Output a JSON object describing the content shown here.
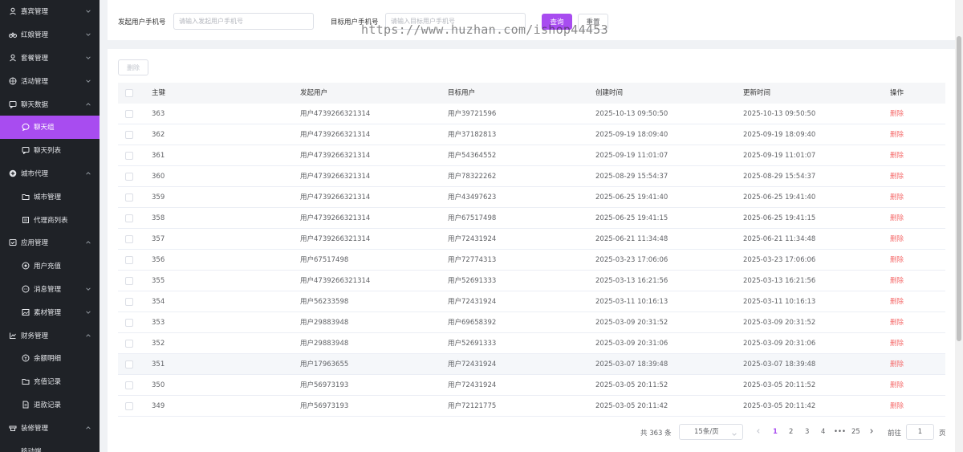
{
  "sidebar": {
    "items": [
      {
        "label": "嘉宾管理",
        "icon": "user-icon",
        "level": "top",
        "chevron": "down"
      },
      {
        "label": "红娘管理",
        "icon": "bike-icon",
        "level": "top",
        "chevron": "down"
      },
      {
        "label": "套餐管理",
        "icon": "user-icon",
        "level": "top",
        "chevron": "down"
      },
      {
        "label": "活动管理",
        "icon": "basketball-icon",
        "level": "top",
        "chevron": "down"
      },
      {
        "label": "聊天数据",
        "icon": "chat-icon",
        "level": "top",
        "chevron": "up"
      },
      {
        "label": "聊天组",
        "icon": "chat-bubble-icon",
        "level": "sub",
        "active": true
      },
      {
        "label": "聊天列表",
        "icon": "chat-icon",
        "level": "sub"
      },
      {
        "label": "城市代理",
        "icon": "plus-circle-icon",
        "level": "top",
        "chevron": "up"
      },
      {
        "label": "城市管理",
        "icon": "folder-icon",
        "level": "sub"
      },
      {
        "label": "代理商列表",
        "icon": "list-icon",
        "level": "sub"
      },
      {
        "label": "应用管理",
        "icon": "app-icon",
        "level": "top",
        "chevron": "up"
      },
      {
        "label": "用户充值",
        "icon": "target-icon",
        "level": "sub"
      },
      {
        "label": "消息管理",
        "icon": "message-icon",
        "level": "sub",
        "chevron": "down"
      },
      {
        "label": "素材管理",
        "icon": "picture-icon",
        "level": "sub",
        "chevron": "down"
      },
      {
        "label": "财务管理",
        "icon": "chart-icon",
        "level": "top",
        "chevron": "up"
      },
      {
        "label": "余额明细",
        "icon": "wallet-icon",
        "level": "sub"
      },
      {
        "label": "充值记录",
        "icon": "folder-icon",
        "level": "sub"
      },
      {
        "label": "退款记录",
        "icon": "document-icon",
        "level": "sub"
      },
      {
        "label": "装修管理",
        "icon": "decor-icon",
        "level": "top",
        "chevron": "up"
      },
      {
        "label": "移动端",
        "icon": "",
        "level": "sub"
      }
    ]
  },
  "search": {
    "from_label": "发起用户手机号",
    "from_placeholder": "请输入发起用户手机号",
    "to_label": "目标用户手机号",
    "to_placeholder": "请输入目标用户手机号",
    "query_label": "查询",
    "reset_label": "重置"
  },
  "watermark": "https://www.huzhan.com/ishop44453",
  "toolbar": {
    "delete_label": "删除"
  },
  "table": {
    "headers": {
      "id": "主键",
      "from": "发起用户",
      "to": "目标用户",
      "created": "创建时间",
      "updated": "更新时间",
      "op": "操作"
    },
    "delete_label": "删除",
    "rows": [
      {
        "id": "363",
        "from": "用户4739266321314",
        "to": "用户39721596",
        "created": "2025-10-13 09:50:50",
        "updated": "2025-10-13 09:50:50"
      },
      {
        "id": "362",
        "from": "用户4739266321314",
        "to": "用户37182813",
        "created": "2025-09-19 18:09:40",
        "updated": "2025-09-19 18:09:40"
      },
      {
        "id": "361",
        "from": "用户4739266321314",
        "to": "用户54364552",
        "created": "2025-09-19 11:01:07",
        "updated": "2025-09-19 11:01:07"
      },
      {
        "id": "360",
        "from": "用户4739266321314",
        "to": "用户78322262",
        "created": "2025-08-29 15:54:37",
        "updated": "2025-08-29 15:54:37"
      },
      {
        "id": "359",
        "from": "用户4739266321314",
        "to": "用户43497623",
        "created": "2025-06-25 19:41:40",
        "updated": "2025-06-25 19:41:40"
      },
      {
        "id": "358",
        "from": "用户4739266321314",
        "to": "用户67517498",
        "created": "2025-06-25 19:41:15",
        "updated": "2025-06-25 19:41:15"
      },
      {
        "id": "357",
        "from": "用户4739266321314",
        "to": "用户72431924",
        "created": "2025-06-21 11:34:48",
        "updated": "2025-06-21 11:34:48"
      },
      {
        "id": "356",
        "from": "用户67517498",
        "to": "用户72774313",
        "created": "2025-03-23 17:06:06",
        "updated": "2025-03-23 17:06:06"
      },
      {
        "id": "355",
        "from": "用户4739266321314",
        "to": "用户52691333",
        "created": "2025-03-13 16:21:56",
        "updated": "2025-03-13 16:21:56"
      },
      {
        "id": "354",
        "from": "用户56233598",
        "to": "用户72431924",
        "created": "2025-03-11 10:16:13",
        "updated": "2025-03-11 10:16:13"
      },
      {
        "id": "353",
        "from": "用户29883948",
        "to": "用户69658392",
        "created": "2025-03-09 20:31:52",
        "updated": "2025-03-09 20:31:52"
      },
      {
        "id": "352",
        "from": "用户29883948",
        "to": "用户52691333",
        "created": "2025-03-09 20:31:06",
        "updated": "2025-03-09 20:31:06"
      },
      {
        "id": "351",
        "from": "用户17963655",
        "to": "用户72431924",
        "created": "2025-03-07 18:39:48",
        "updated": "2025-03-07 18:39:48",
        "hover": true
      },
      {
        "id": "350",
        "from": "用户56973193",
        "to": "用户72431924",
        "created": "2025-03-05 20:11:52",
        "updated": "2025-03-05 20:11:52"
      },
      {
        "id": "349",
        "from": "用户56973193",
        "to": "用户72121775",
        "created": "2025-03-05 20:11:42",
        "updated": "2025-03-05 20:11:42"
      }
    ]
  },
  "pagination": {
    "total_text": "共 363 条",
    "page_size": "15条/页",
    "pages": [
      "1",
      "2",
      "3",
      "4",
      "•••",
      "25"
    ],
    "current": "1",
    "goto_label": "前往",
    "goto_value": "1",
    "page_label": "页"
  },
  "colors": {
    "accent": "#a84cf0",
    "sidebar_bg": "#1f2227",
    "danger": "#f56c6c"
  }
}
